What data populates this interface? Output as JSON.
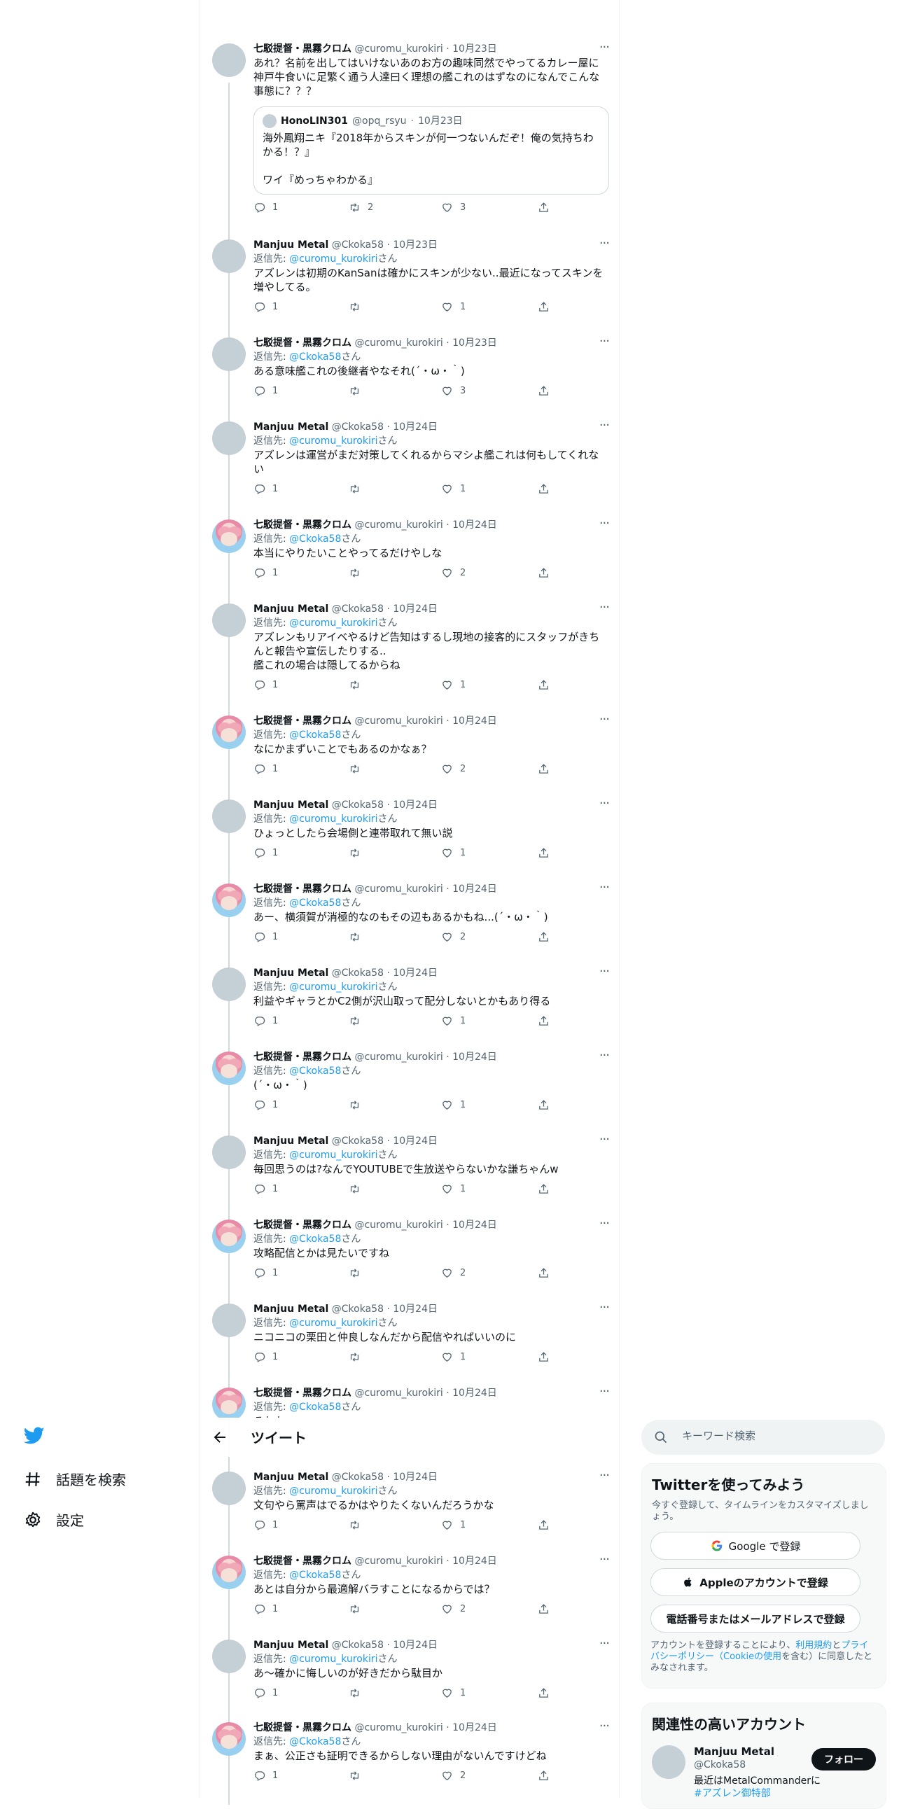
{
  "header": {
    "title": "ツイート"
  },
  "nav": {
    "explore": "話題を検索",
    "settings": "設定"
  },
  "search": {
    "placeholder": "キーワード検索"
  },
  "signup": {
    "title": "Twitterを使ってみよう",
    "subtitle": "今すぐ登録して、タイムラインをカスタマイズしましょう。",
    "google": "Google で登録",
    "apple": "Appleのアカウントで登録",
    "phone": "電話番号またはメールアドレスで登録",
    "terms_1": "アカウントを登録することにより、",
    "terms_link1": "利用規約",
    "terms_2": "と",
    "terms_link2": "プライバシーポリシー（Cookieの使用",
    "terms_3": "を含む）に同意したとみなされます。"
  },
  "related": {
    "title": "関連性の高いアカウント",
    "name": "Manjuu Metal",
    "handle": "@Ckoka58",
    "bio": "最近はMetalCommanderに",
    "bio_tag": "#アズレン",
    "bio_tail": "御特部",
    "follow": "フォロー"
  },
  "quote": {
    "name": "HonoLIN301",
    "handle": "@opq_rsyu",
    "date": "10月23日",
    "text": "海外鳳翔ニキ『2018年からスキンが何一つないんだぞ！俺の気持ちわかる！？』\n\nワイ『めっちゃわかる』"
  },
  "tweets": [
    {
      "name": "七駁提督・黒霧クロム",
      "handle": "@curomu_kurokiri",
      "date": "10月23日",
      "reply_to": "",
      "text": "あれ？名前を出してはいけないあのお方の趣味同然でやってるカレー屋に神戸牛食いに足繁く通う人達曰く理想の艦これのはずなのになんでこんな事態に？？？",
      "replies": "1",
      "retweets": "2",
      "likes": "3"
    },
    {
      "name": "Manjuu Metal",
      "handle": "@Ckoka58",
      "date": "10月23日",
      "reply_to": "@curomu_kurokiri",
      "text": "アズレンは初期のKanSanは確かにスキンが少ない..最近になってスキンを増やしてる。",
      "replies": "1",
      "retweets": "",
      "likes": "1"
    },
    {
      "name": "七駁提督・黒霧クロム",
      "handle": "@curomu_kurokiri",
      "date": "10月23日",
      "reply_to": "@Ckoka58",
      "text": "ある意味艦これの後継者やなそれ(´・ω・｀)",
      "replies": "1",
      "retweets": "",
      "likes": "3"
    },
    {
      "name": "Manjuu Metal",
      "handle": "@Ckoka58",
      "date": "10月24日",
      "reply_to": "@curomu_kurokiri",
      "text": "アズレンは運営がまだ対策してくれるからマシよ艦これは何もしてくれない",
      "replies": "1",
      "retweets": "",
      "likes": "1"
    },
    {
      "name": "七駁提督・黒霧クロム",
      "handle": "@curomu_kurokiri",
      "date": "10月24日",
      "reply_to": "@Ckoka58",
      "text": "本当にやりたいことやってるだけやしな",
      "replies": "1",
      "retweets": "",
      "likes": "2"
    },
    {
      "name": "Manjuu Metal",
      "handle": "@Ckoka58",
      "date": "10月24日",
      "reply_to": "@curomu_kurokiri",
      "text": "アズレンもリアイベやるけど告知はするし現地の接客的にスタッフがきちんと報告や宣伝したりする..\n艦これの場合は隠してるからね",
      "replies": "1",
      "retweets": "",
      "likes": "1"
    },
    {
      "name": "七駁提督・黒霧クロム",
      "handle": "@curomu_kurokiri",
      "date": "10月24日",
      "reply_to": "@Ckoka58",
      "text": "なにかまずいことでもあるのかなぁ？",
      "replies": "1",
      "retweets": "",
      "likes": "2"
    },
    {
      "name": "Manjuu Metal",
      "handle": "@Ckoka58",
      "date": "10月24日",
      "reply_to": "@curomu_kurokiri",
      "text": "ひょっとしたら会場側と連帯取れて無い説",
      "replies": "1",
      "retweets": "",
      "likes": "1"
    },
    {
      "name": "七駁提督・黒霧クロム",
      "handle": "@curomu_kurokiri",
      "date": "10月24日",
      "reply_to": "@Ckoka58",
      "text": "あー、横須賀が消極的なのもその辺もあるかもね...(´・ω・｀)",
      "replies": "1",
      "retweets": "",
      "likes": "2"
    },
    {
      "name": "Manjuu Metal",
      "handle": "@Ckoka58",
      "date": "10月24日",
      "reply_to": "@curomu_kurokiri",
      "text": "利益やギャラとかC2側が沢山取って配分しないとかもあり得る",
      "replies": "1",
      "retweets": "",
      "likes": "1"
    },
    {
      "name": "七駁提督・黒霧クロム",
      "handle": "@curomu_kurokiri",
      "date": "10月24日",
      "reply_to": "@Ckoka58",
      "text": "(´・ω・｀)",
      "replies": "1",
      "retweets": "",
      "likes": "1"
    },
    {
      "name": "Manjuu Metal",
      "handle": "@Ckoka58",
      "date": "10月24日",
      "reply_to": "@curomu_kurokiri",
      "text": "毎回思うのは?なんでYOUTUBEで生放送やらないかな謙ちゃんw",
      "replies": "1",
      "retweets": "",
      "likes": "1"
    },
    {
      "name": "七駁提督・黒霧クロム",
      "handle": "@curomu_kurokiri",
      "date": "10月24日",
      "reply_to": "@Ckoka58",
      "text": "攻略配信とかは見たいですね",
      "replies": "1",
      "retweets": "",
      "likes": "2"
    },
    {
      "name": "Manjuu Metal",
      "handle": "@Ckoka58",
      "date": "10月24日",
      "reply_to": "@curomu_kurokiri",
      "text": "ニコニコの栗田と仲良しなんだから配信やればいいのに",
      "replies": "1",
      "retweets": "",
      "likes": "1"
    },
    {
      "name": "七駁提督・黒霧クロム",
      "handle": "@curomu_kurokiri",
      "date": "10月24日",
      "reply_to": "@Ckoka58",
      "text": "それな",
      "replies": "",
      "retweets": "",
      "likes": ""
    },
    {
      "name": "Manjuu Metal",
      "handle": "@Ckoka58",
      "date": "10月24日",
      "reply_to": "@curomu_kurokiri",
      "text": "文句やら罵声はでるかはやりたくないんだろうかな",
      "replies": "1",
      "retweets": "",
      "likes": "1"
    },
    {
      "name": "七駁提督・黒霧クロム",
      "handle": "@curomu_kurokiri",
      "date": "10月24日",
      "reply_to": "@Ckoka58",
      "text": "あとは自分から最適解バラすことになるからでは？",
      "replies": "1",
      "retweets": "",
      "likes": "2"
    },
    {
      "name": "Manjuu Metal",
      "handle": "@Ckoka58",
      "date": "10月24日",
      "reply_to": "@curomu_kurokiri",
      "text": "あ〜確かに悔しいのが好きだから駄目か",
      "replies": "1",
      "retweets": "",
      "likes": "1"
    },
    {
      "name": "七駁提督・黒霧クロム",
      "handle": "@curomu_kurokiri",
      "date": "10月24日",
      "reply_to": "@Ckoka58",
      "text": "まぁ、公正さも証明できるからしない理由がないんですけどね",
      "replies": "1",
      "retweets": "",
      "likes": "2"
    }
  ],
  "reply_prefix": "返信先: ",
  "reply_suffix": "さん"
}
